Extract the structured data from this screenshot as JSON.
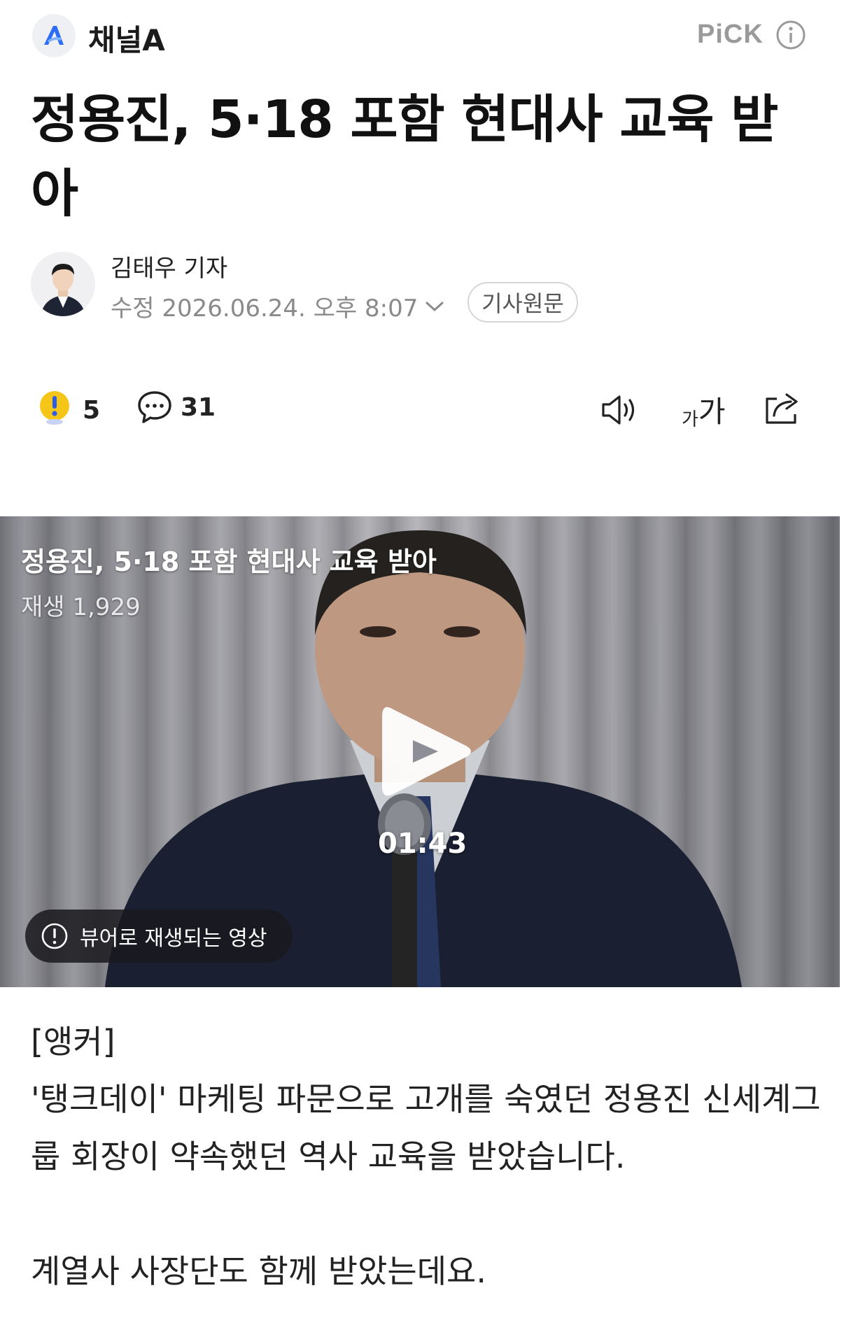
{
  "header": {
    "brand": "채널A",
    "pick_label": "PiCK"
  },
  "article": {
    "headline": "정용진, 5·18 포함 현대사 교육 받아",
    "author": "김태우 기자",
    "dateline": "수정 2026.06.24. 오후 8:07",
    "original_button": "기사원문"
  },
  "actions": {
    "reaction_count": "5",
    "comment_count": "31",
    "icons": [
      "reaction-icon",
      "comment-icon",
      "speaker-icon",
      "font-size-icon",
      "share-icon"
    ],
    "font_size_label_small": "가",
    "font_size_label_large": "가"
  },
  "video": {
    "title": "정용진, 5·18 포함 현대사 교육 받아",
    "plays": "재생 1,929",
    "duration": "01:43",
    "notice": "뷰어로 재생되는 영상"
  },
  "body": {
    "paragraphs": [
      "[앵커]",
      "'탱크데이' 마케팅 파문으로 고개를 숙였던 정용진 신세계그룹 회장이 약속했던 역사 교육을 받았습니다.",
      "",
      "계열사 사장단도 함께 받았는데요."
    ]
  },
  "colors": {
    "accent_yellow": "#F5C518",
    "logo_blue": "#2C6CF6",
    "muted_gray": "#8A8A8A"
  }
}
